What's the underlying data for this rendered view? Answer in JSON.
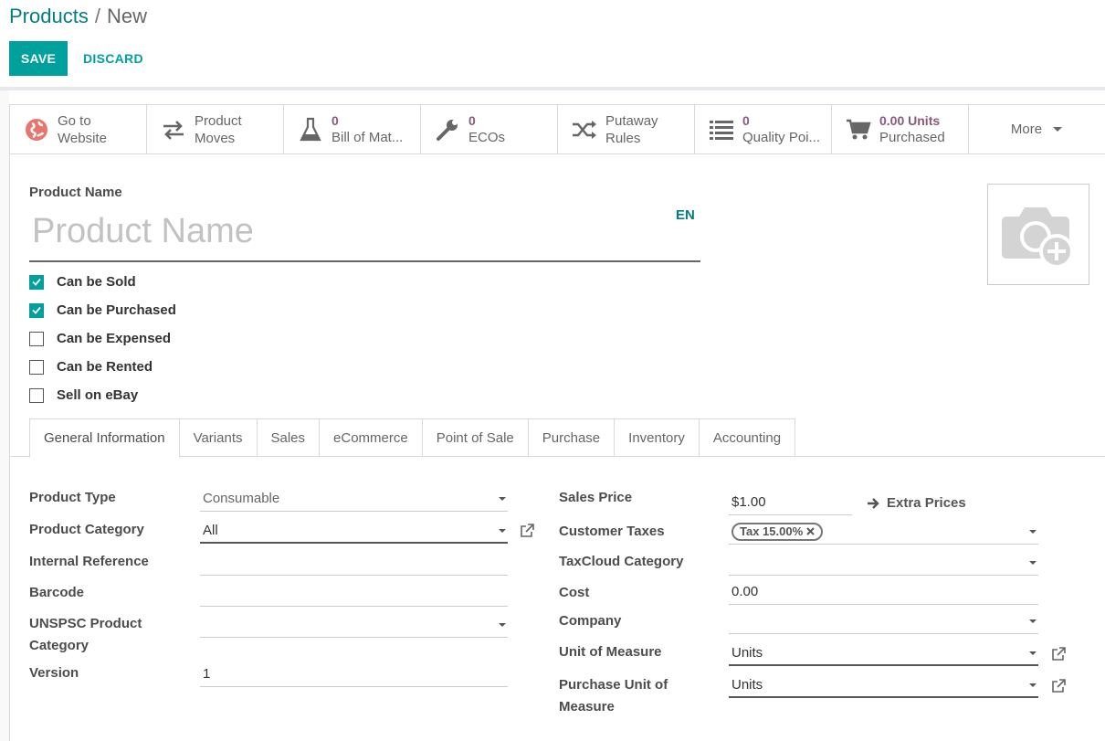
{
  "breadcrumb": {
    "parent": "Products",
    "separator": "/",
    "current": "New"
  },
  "actions": {
    "save": "SAVE",
    "discard": "DISCARD"
  },
  "smart_buttons": [
    {
      "icon": "globe-icon",
      "line1": "Go to",
      "line2": "Website"
    },
    {
      "icon": "exchange-icon",
      "line1": "Product",
      "line2": "Moves"
    },
    {
      "icon": "flask-icon",
      "value": "0",
      "line2": "Bill of Mat..."
    },
    {
      "icon": "wrench-icon",
      "value": "0",
      "line2": "ECOs"
    },
    {
      "icon": "random-icon",
      "line1": "Putaway",
      "line2": "Rules"
    },
    {
      "icon": "list-icon",
      "value": "0",
      "line2": "Quality Poi..."
    },
    {
      "icon": "cart-icon",
      "value": "0.00 Units",
      "line2": "Purchased"
    },
    {
      "label": "More"
    }
  ],
  "product_name": {
    "label": "Product Name",
    "placeholder": "Product Name",
    "lang": "EN"
  },
  "checkboxes": [
    {
      "label": "Can be Sold",
      "checked": true
    },
    {
      "label": "Can be Purchased",
      "checked": true
    },
    {
      "label": "Can be Expensed",
      "checked": false
    },
    {
      "label": "Can be Rented",
      "checked": false
    },
    {
      "label": "Sell on eBay",
      "checked": false
    }
  ],
  "tabs": [
    "General Information",
    "Variants",
    "Sales",
    "eCommerce",
    "Point of Sale",
    "Purchase",
    "Inventory",
    "Accounting"
  ],
  "active_tab": "General Information",
  "left_fields": {
    "product_type": {
      "label": "Product Type",
      "value": "Consumable"
    },
    "product_category": {
      "label": "Product Category",
      "value": "All"
    },
    "internal_reference": {
      "label": "Internal Reference",
      "value": ""
    },
    "barcode": {
      "label": "Barcode",
      "value": ""
    },
    "unspsc": {
      "label_line1": "UNSPSC Product",
      "label_line2": "Category",
      "value": ""
    },
    "version": {
      "label": "Version",
      "value": "1"
    }
  },
  "right_fields": {
    "sales_price": {
      "label": "Sales Price",
      "value": "$1.00",
      "extra": "Extra Prices"
    },
    "customer_taxes": {
      "label": "Customer Taxes",
      "tag": "Tax 15.00%"
    },
    "taxcloud": {
      "label": "TaxCloud Category",
      "value": ""
    },
    "cost": {
      "label": "Cost",
      "value": "0.00"
    },
    "company": {
      "label": "Company",
      "value": ""
    },
    "uom": {
      "label": "Unit of Measure",
      "value": "Units"
    },
    "purchase_uom": {
      "label_line1": "Purchase Unit of",
      "label_line2": "Measure",
      "value": "Units"
    }
  },
  "colors": {
    "primary": "#00a09d",
    "link": "#017e84",
    "stat_value": "#875a7b"
  }
}
